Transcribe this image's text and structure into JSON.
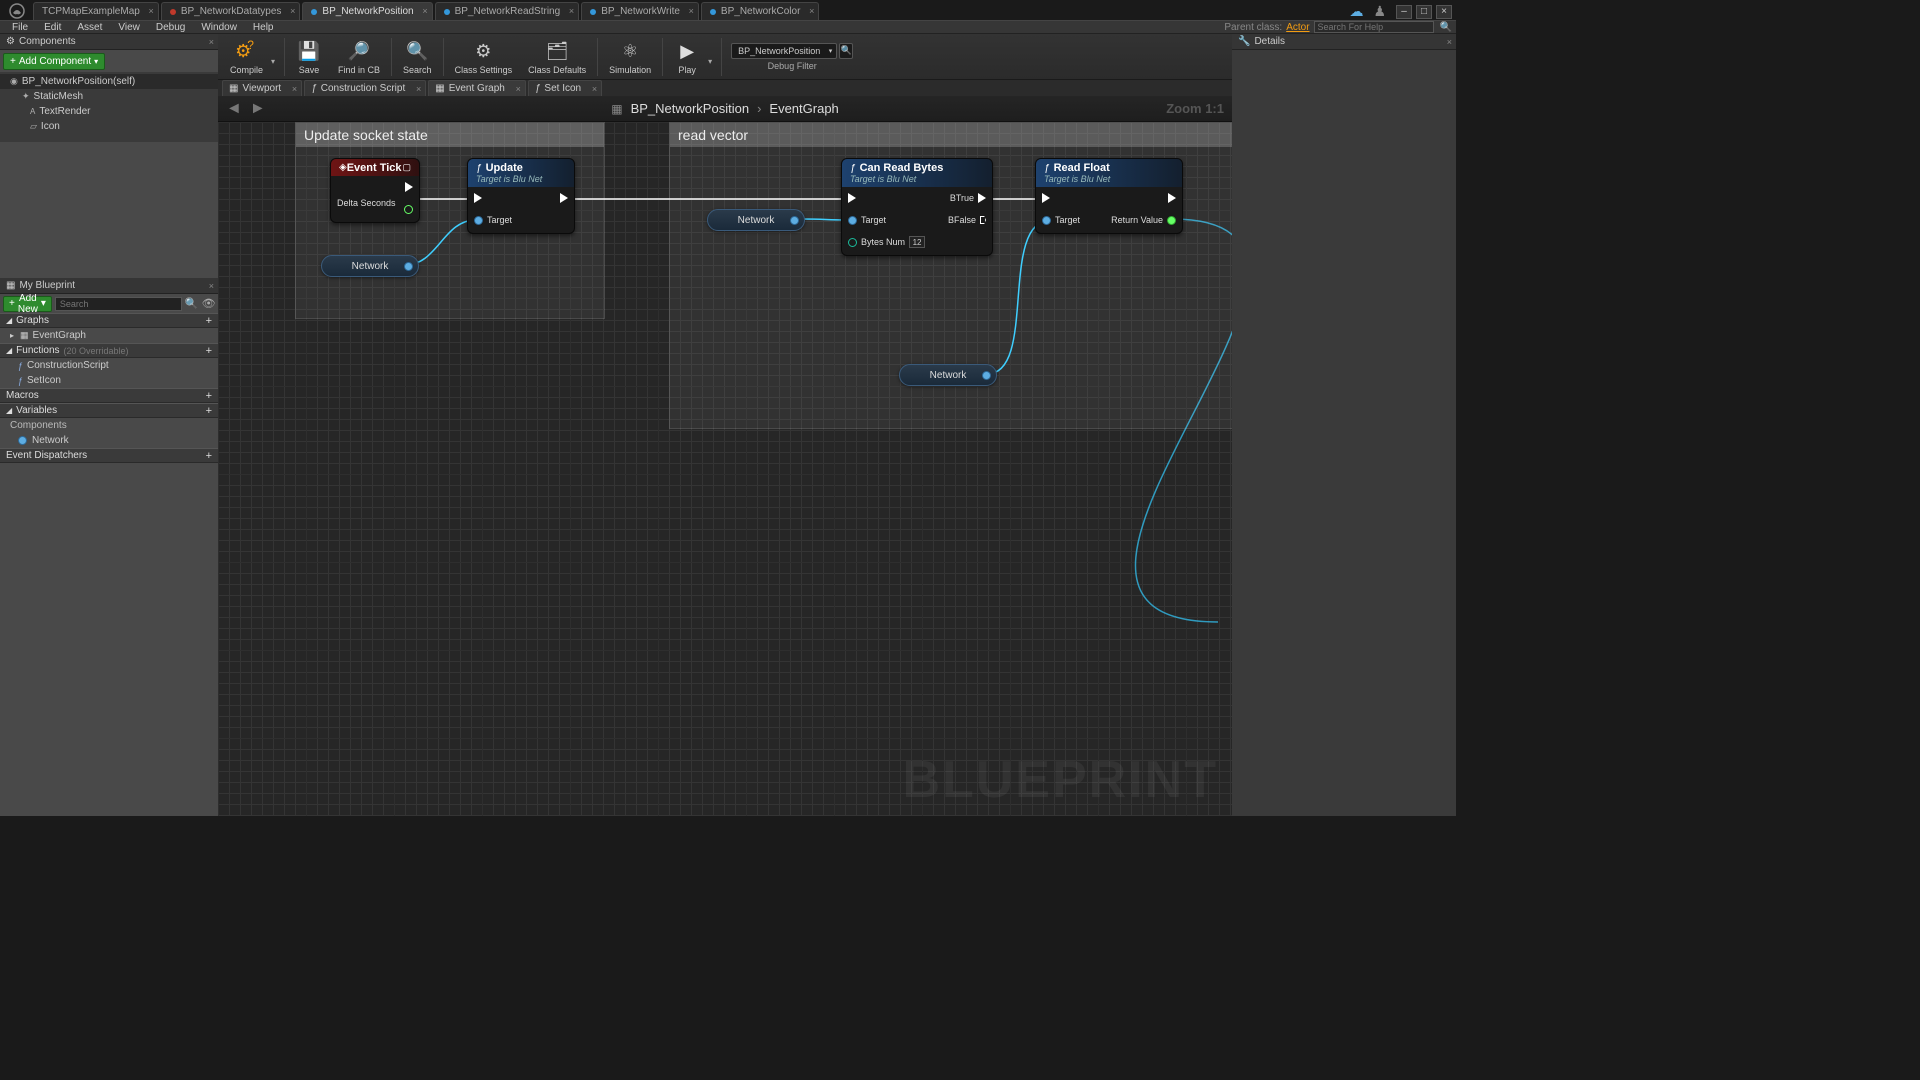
{
  "top_tabs": [
    "TCPMapExampleMap",
    "BP_NetworkDatatypes",
    "BP_NetworkPosition",
    "BP_NetworkReadString",
    "BP_NetworkWrite",
    "BP_NetworkColor"
  ],
  "active_top_tab": 2,
  "menu": [
    "File",
    "Edit",
    "Asset",
    "View",
    "Debug",
    "Window",
    "Help"
  ],
  "parent_class_label": "Parent class:",
  "parent_class": "Actor",
  "help_search_placeholder": "Search For Help",
  "components_panel": {
    "title": "Components",
    "add_btn": "Add Component",
    "items": [
      {
        "name": "BP_NetworkPosition(self)",
        "level": 0,
        "ico": "◉"
      },
      {
        "name": "StaticMesh",
        "level": 1,
        "ico": "✦"
      },
      {
        "name": "TextRender",
        "level": 2,
        "ico": "A"
      },
      {
        "name": "Icon",
        "level": 2,
        "ico": "▱"
      }
    ]
  },
  "my_blueprint": {
    "title": "My Blueprint",
    "add_new": "Add New",
    "search_placeholder": "Search",
    "sections": {
      "graphs": {
        "label": "Graphs",
        "items": [
          "EventGraph"
        ]
      },
      "functions": {
        "label": "Functions",
        "note": "(20 Overridable)",
        "items": [
          "ConstructionScript",
          "SetIcon"
        ]
      },
      "macros": {
        "label": "Macros"
      },
      "variables": {
        "label": "Variables",
        "sub_label": "Components",
        "items": [
          "Network"
        ]
      },
      "dispatchers": {
        "label": "Event Dispatchers"
      }
    }
  },
  "toolbar": {
    "compile": "Compile",
    "save": "Save",
    "find_in_cb": "Find in CB",
    "search": "Search",
    "class_settings": "Class Settings",
    "class_defaults": "Class Defaults",
    "simulation": "Simulation",
    "play": "Play",
    "debug_filter_label": "Debug Filter",
    "debug_filter_value": "BP_NetworkPosition"
  },
  "graph_tabs": [
    {
      "label": "Viewport",
      "ico": "▦"
    },
    {
      "label": "Construction Script",
      "ico": "ƒ"
    },
    {
      "label": "Event Graph",
      "ico": "▦",
      "active": true
    },
    {
      "label": "Set Icon",
      "ico": "ƒ"
    }
  ],
  "breadcrumb": {
    "root": "BP_NetworkPosition",
    "leaf": "EventGraph"
  },
  "zoom": "Zoom 1:1",
  "comments": {
    "c1": "Update socket state",
    "c2": "read vector"
  },
  "nodes": {
    "event_tick": {
      "title": "Event Tick",
      "out_label": "Delta Seconds"
    },
    "update": {
      "title": "Update",
      "sub": "Target is Blu Net",
      "target": "Target"
    },
    "can_read": {
      "title": "Can Read Bytes",
      "sub": "Target is Blu Net",
      "target": "Target",
      "bytes": "Bytes Num",
      "bytes_val": "12",
      "btrue": "BTrue",
      "bfalse": "BFalse"
    },
    "read_float": {
      "title": "Read Float",
      "sub": "Target is Blu Net",
      "target": "Target",
      "ret": "Return Value"
    },
    "var_network": "Network"
  },
  "details_panel": {
    "title": "Details"
  },
  "watermark": "BLUEPRINT"
}
